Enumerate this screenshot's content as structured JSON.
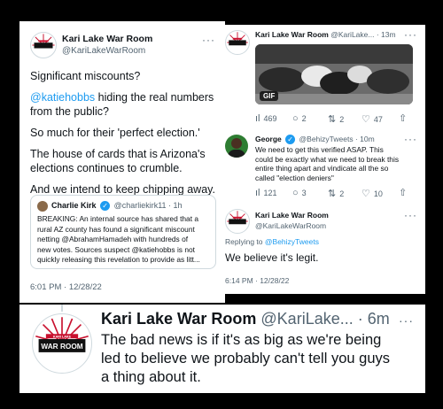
{
  "left_tweet": {
    "name": "Kari Lake War Room",
    "handle": "@KariLakeWarRoom",
    "lines": [
      "Significant miscounts?",
      "hiding the real numbers",
      "from the public?",
      "So much for their 'perfect election.'",
      "The house of cards that is Arizona's",
      "elections continues to crumble.",
      "And we intend to keep chipping away."
    ],
    "mention": "@katiehobbs",
    "timestamp": "6:01 PM · 12/28/22",
    "more": "···",
    "quote": {
      "name": "Charlie Kirk",
      "handle": "@charliekirk11 · 1h",
      "lines": [
        "BREAKING: An internal source has shared that a",
        "rural AZ county has found a significant miscount",
        "netting @AbrahamHamadeh with hundreds of",
        "new votes. Sources suspect @katiehobbs is not",
        "quickly releasing this revelation to provide as litt..."
      ]
    }
  },
  "top_right_tweet": {
    "name": "Kari Lake War Room",
    "handle_time": "@KariLake... · 13m",
    "gif_label": "GIF",
    "more": "···",
    "stats": {
      "views": "469",
      "replies": "2",
      "retweets": "2",
      "likes": "47"
    }
  },
  "george_tweet": {
    "name": "George",
    "handle_time": "@BehizyTweets · 10m",
    "lines": [
      "We need to get this verified ASAP. This",
      "could be exactly what we need to break this",
      "entire thing apart and vindicate all the so",
      "called \"election deniers\""
    ],
    "more": "···",
    "stats": {
      "views": "121",
      "replies": "3",
      "retweets": "2",
      "likes": "10"
    }
  },
  "reply_tweet": {
    "name": "Kari Lake War Room",
    "handle": "@KariLakeWarRoom",
    "replying_prefix": "Replying to",
    "replying_handle": "@BehizyTweets",
    "text": "We believe it's legit.",
    "timestamp": "6:14 PM · 12/28/22",
    "more": "···"
  },
  "bottom_tweet": {
    "name": "Kari Lake War Room",
    "handle_time": "@KariLake... · 6m",
    "lines": [
      "The bad news is if it's as big as we're being",
      "led to believe we probably can't tell you guys",
      "a thing about it."
    ],
    "more": "···"
  },
  "logo": {
    "top": "KARI LAKE",
    "main1": "WAR",
    "main2": "ROOM"
  },
  "colors": {
    "link": "#1d9bf0",
    "muted": "#536471",
    "logo_red": "#c8102e"
  }
}
